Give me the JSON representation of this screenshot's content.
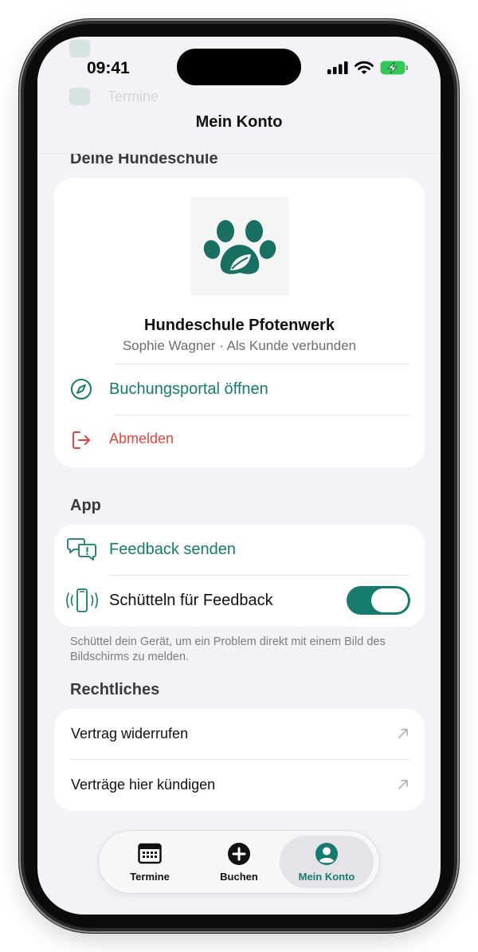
{
  "status_bar": {
    "time": "09:41"
  },
  "nav": {
    "title": "Mein Konto",
    "ghost_text_1": "Hundeschule",
    "ghost_text_2": "Termine"
  },
  "sections": {
    "school_header": "Deine Hundeschule",
    "app_header": "App",
    "legal_header": "Rechtliches"
  },
  "school": {
    "name": "Hundeschule Pfotenwerk",
    "subtitle": "Sophie Wagner · Als Kunde verbunden",
    "logo_icon": "paw-leaf-icon",
    "brand_color": "#1a6f63",
    "actions": [
      {
        "label": "Buchungsportal öffnen",
        "icon": "compass-icon",
        "color": "#167a6e"
      },
      {
        "label": "Abmelden",
        "icon": "logout-icon",
        "color": "#e0463e"
      }
    ]
  },
  "app": {
    "feedback_label": "Feedback senden",
    "shake_label": "Schütteln für Feedback",
    "shake_enabled": true,
    "footnote": "Schüttel dein Gerät, um ein Problem direkt mit einem Bild des Bildschirms zu melden."
  },
  "legal": {
    "items": [
      {
        "label": "Vertrag widerrufen",
        "icon": "external-arrow-icon"
      },
      {
        "label": "Verträge hier kündigen",
        "icon": "external-arrow-icon"
      }
    ]
  },
  "tabbar": {
    "tabs": [
      {
        "label": "Termine",
        "icon": "calendar-icon",
        "active": false
      },
      {
        "label": "Buchen",
        "icon": "plus-circle-icon",
        "active": false
      },
      {
        "label": "Mein Konto",
        "icon": "person-circle-icon",
        "active": true
      }
    ],
    "accent": "#167a6e"
  }
}
